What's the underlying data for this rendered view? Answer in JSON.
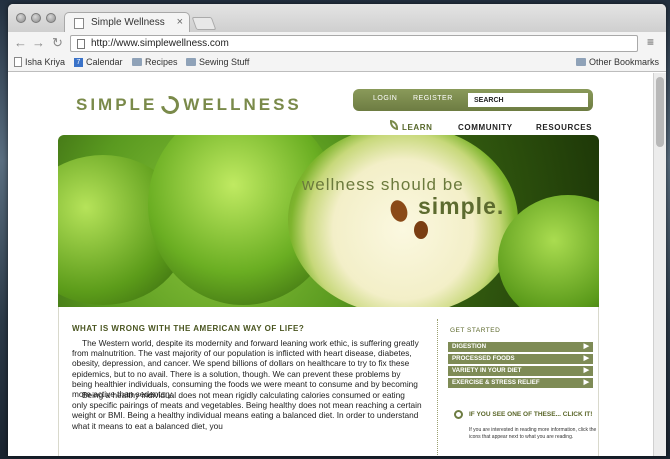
{
  "browser": {
    "tab_title": "Simple Wellness",
    "url": "http://www.simplewellness.com",
    "bookmarks": [
      {
        "label": "Isha Kriya",
        "icon": "page-icon"
      },
      {
        "label": "Calendar",
        "icon": "calendar-icon"
      },
      {
        "label": "Recipes",
        "icon": "folder-icon"
      },
      {
        "label": "Sewing Stuff",
        "icon": "folder-icon"
      }
    ],
    "other_bookmarks": "Other Bookmarks"
  },
  "site": {
    "logo_left": "SIMPLE",
    "logo_right": "WELLNESS",
    "login": "LOGIN",
    "register": "REGISTER",
    "search_value": "SEARCH",
    "nav": [
      "LEARN",
      "COMMUNITY",
      "RESOURCES"
    ],
    "hero_line1": "wellness should be",
    "hero_line2": "simple."
  },
  "article": {
    "title": "WHAT IS WRONG WITH THE AMERICAN WAY OF LIFE?",
    "p1": "The Western world, despite its modernity and forward leaning work ethic, is suffering greatly from malnutrition. The vast majority of our population is inflicted with heart disease, diabetes, obesity, depression, and cancer. We spend billions of dollars on healthcare to try to fix these epidemics, but to no avail. There is a solution, though. We can prevent these problems by being healthier individuals, consuming the foods we were meant to consume and by becoming more active than sedentary.",
    "p2": "Being a healthy individual does not mean rigidly calculating calories consumed or eating only specific pairings of meats and vegetables. Being healthy does not mean reaching a certain weight or BMI. Being a healthy individual means eating a balanced diet. In order to understand what it means to eat a balanced diet, you"
  },
  "sidebar": {
    "title": "GET STARTED",
    "items": [
      "DIGESTION",
      "PROCESSED FOODS",
      "VARIETY IN YOUR DIET",
      "EXERCISE & STRESS RELIEF"
    ],
    "clickit_title": "IF YOU SEE ONE OF THESE... CLICK IT!",
    "clickit_text": "If you are interested in reading more information, click the icons that appear next to what you are reading."
  }
}
